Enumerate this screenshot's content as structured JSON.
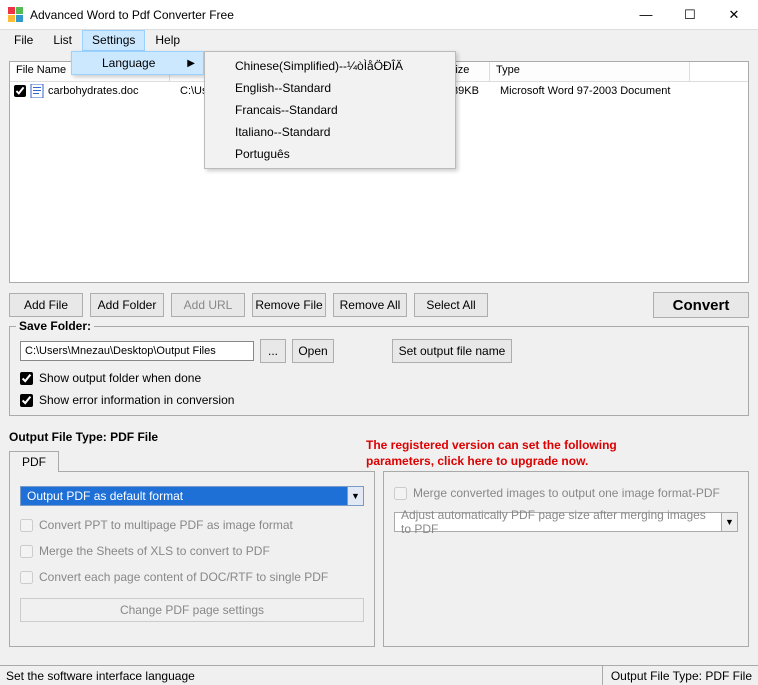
{
  "app": {
    "title": "Advanced Word to Pdf Converter Free"
  },
  "menu": {
    "file": "File",
    "list": "List",
    "settings": "Settings",
    "help": "Help"
  },
  "submenu": {
    "language": "Language",
    "langs": [
      "Chinese(Simplified)--¼òÌåÖÐÎÄ",
      "English--Standard",
      "Francais--Standard",
      "Italiano--Standard",
      "Português"
    ]
  },
  "cols": {
    "name": "File Name",
    "size": "Size",
    "type": "Type"
  },
  "file": {
    "name": "carbohydrates.doc",
    "path": "C:\\Us",
    "size": "39KB",
    "type": "Microsoft Word 97-2003 Document"
  },
  "buttons": {
    "add_file": "Add File",
    "add_folder": "Add Folder",
    "add_url": "Add URL",
    "remove_file": "Remove File",
    "remove_all": "Remove All",
    "select_all": "Select All",
    "convert": "Convert",
    "browse": "...",
    "open": "Open",
    "set_output": "Set output file name",
    "change_pdf": "Change PDF page settings"
  },
  "save": {
    "legend": "Save Folder:",
    "path": "C:\\Users\\Mnezau\\Desktop\\Output Files",
    "show_folder": "Show output folder when done",
    "show_error": "Show error information in conversion"
  },
  "oft": {
    "label": "Output File Type:  PDF File",
    "tab": "PDF"
  },
  "reg": {
    "line1": "The registered version can set the following",
    "line2": "parameters, click here to upgrade now."
  },
  "left_panel": {
    "combo": "Output PDF as default format",
    "opt1": "Convert PPT to multipage PDF as image format",
    "opt2": "Merge the Sheets of XLS to convert to PDF",
    "opt3": "Convert each page content of DOC/RTF to single PDF"
  },
  "right_panel": {
    "opt1": "Merge converted images to output one image format-PDF",
    "combo": "Adjust automatically PDF page size after merging images to PDF"
  },
  "status": {
    "left": "Set the software interface language",
    "right": "Output File Type:  PDF File"
  }
}
